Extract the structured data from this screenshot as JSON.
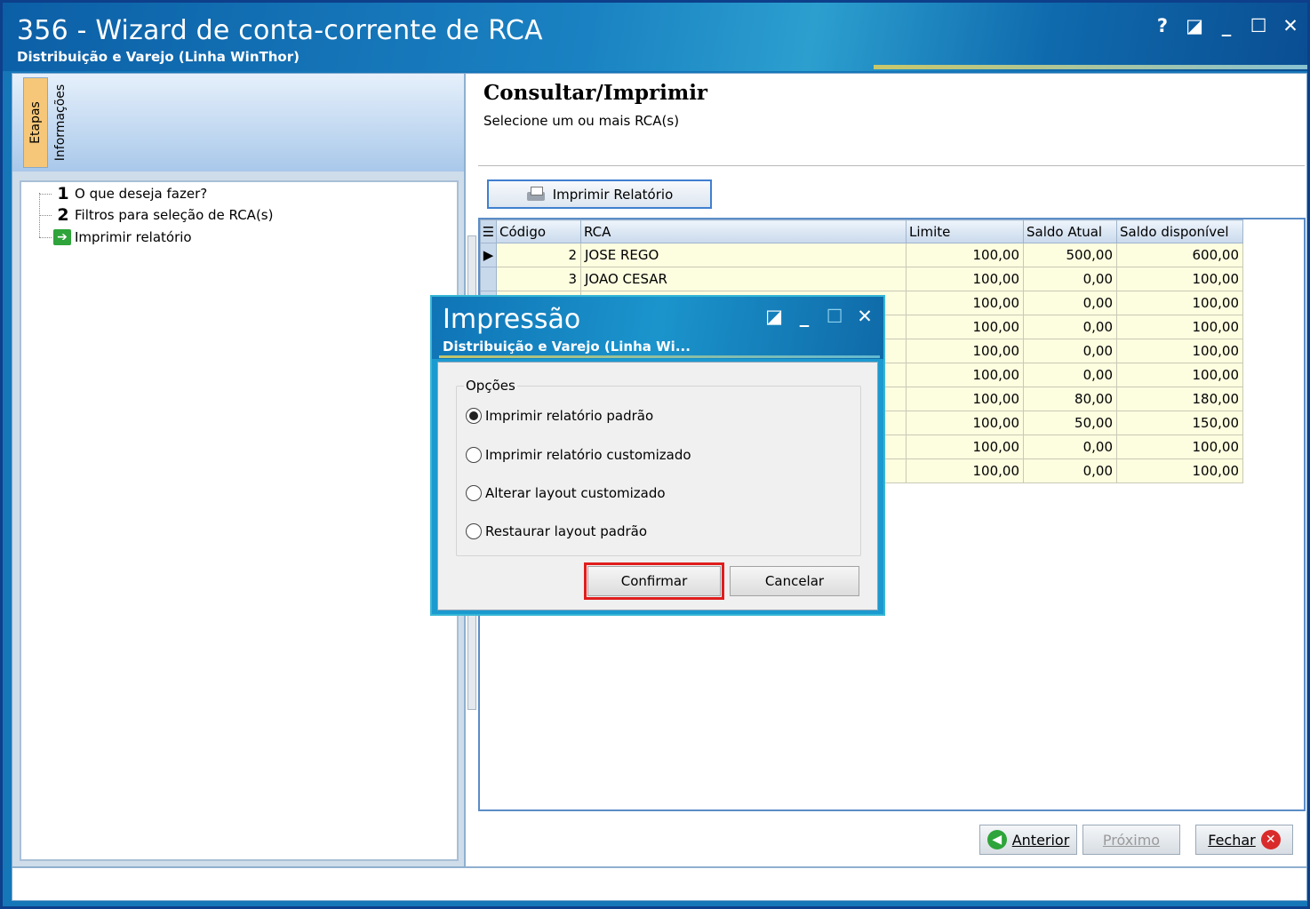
{
  "window": {
    "title": "356 - Wizard de conta-corrente de RCA",
    "subtitle": "Distribuição e Varejo (Linha WinThor)",
    "controls": {
      "help": "?",
      "restore": "◪",
      "minimize": "_",
      "maximize": "☐",
      "close": "✕"
    }
  },
  "left": {
    "tabs": [
      "Etapas",
      "Informações"
    ],
    "steps": [
      {
        "num": "1",
        "label": "O que deseja fazer?"
      },
      {
        "num": "2",
        "label": "Filtros para seleção de RCA(s)"
      },
      {
        "num": "",
        "label": "Imprimir relatório",
        "icon": "green-arrow-icon"
      }
    ]
  },
  "main": {
    "heading": "Consultar/Imprimir",
    "subheading": "Selecione um ou mais RCA(s)",
    "print_button": "Imprimir Relatório",
    "columns": [
      "Código",
      "RCA",
      "Limite",
      "Saldo Atual",
      "Saldo disponível"
    ],
    "rows": [
      [
        "2",
        "JOSE REGO",
        "100,00",
        "500,00",
        "600,00"
      ],
      [
        "3",
        "JOAO CESAR",
        "100,00",
        "0,00",
        "100,00"
      ],
      [
        "",
        "",
        "100,00",
        "0,00",
        "100,00"
      ],
      [
        "",
        "",
        "100,00",
        "0,00",
        "100,00"
      ],
      [
        "",
        "",
        "100,00",
        "0,00",
        "100,00"
      ],
      [
        "",
        "",
        "100,00",
        "0,00",
        "100,00"
      ],
      [
        "",
        "",
        "100,00",
        "80,00",
        "180,00"
      ],
      [
        "",
        "",
        "100,00",
        "50,00",
        "150,00"
      ],
      [
        "",
        "",
        "100,00",
        "0,00",
        "100,00"
      ],
      [
        "",
        "",
        "100,00",
        "0,00",
        "100,00"
      ]
    ]
  },
  "footer": {
    "prev": "Anterior",
    "next": "Próximo",
    "close": "Fechar"
  },
  "dialog": {
    "title": "Impressão",
    "subtitle": "Distribuição e Varejo (Linha Wi...",
    "group_label": "Opções",
    "options": [
      {
        "label": "Imprimir relatório padrão",
        "selected": true
      },
      {
        "label": "Imprimir relatório customizado",
        "selected": false
      },
      {
        "label": "Alterar layout customizado",
        "selected": false
      },
      {
        "label": "Restaurar layout padrão",
        "selected": false
      }
    ],
    "confirm": "Confirmar",
    "cancel": "Cancelar"
  },
  "colors": {
    "title_blue": "#1576b8",
    "highlight_red": "#e01d1d",
    "grid_cell": "#fdfde0"
  }
}
